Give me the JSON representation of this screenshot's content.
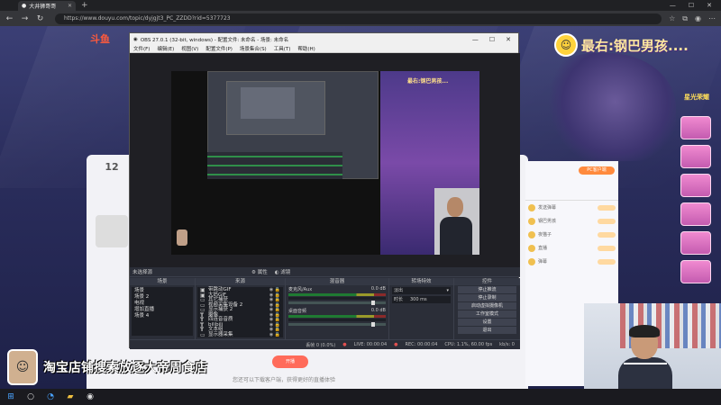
{
  "browser": {
    "tab_title": "大井狮哥哥",
    "url": "https://www.douyu.com/topic/dyjgjt3_PC_ZZDD?rid=5377723",
    "new_tab": "+",
    "win_min": "—",
    "win_max": "☐",
    "win_close": "✕"
  },
  "page": {
    "banner_text": "最右:钢巴男孩....",
    "brand": "斗鱼",
    "count": "12",
    "count_sub": "",
    "ribbon_text": "淘宝店铺搜索放逐大帝周食店",
    "bottom_button": "开播",
    "bottom_note": "您还可以下载客户端，获得更好的直播体验",
    "side_top": "星光荣耀"
  },
  "chat": {
    "pill": "PC客户端",
    "rows": [
      "发送弹幕",
      "钢巴男孩",
      "夜猫子",
      "直播",
      "弹幕"
    ]
  },
  "obs": {
    "title": "OBS 27.0.1 (32-bit, windows) - 配置文件: 未命名 - 场景: 未命名",
    "menu": [
      "文件(F)",
      "编辑(E)",
      "视图(V)",
      "配置文件(P)",
      "场景集合(S)",
      "工具(T)",
      "帮助(H)"
    ],
    "no_source_selected": "未选择源",
    "properties": "属性",
    "filters": "滤镜",
    "docks": {
      "scenes": "场景",
      "sources": "来源",
      "mixer": "混音器",
      "transitions": "转场特效",
      "controls": "控件"
    },
    "scenes": [
      "场景",
      "场景 2",
      "电视",
      "增加直播",
      "场景 4"
    ],
    "sources": [
      "带跳动GIF",
      "大妈GIF",
      "其它捕获",
      "视频采集设备 2",
      "显示捕获 2",
      "摄像",
      "四连音音质",
      "bilibili",
      "文本组",
      "显示器采集"
    ],
    "mixer": [
      {
        "name": "桌面音频",
        "value": "0.0 dB"
      },
      {
        "name": "麦克风/Aux",
        "value": "0.0 dB"
      }
    ],
    "transition": {
      "type_label": "",
      "type_value": "淡出",
      "duration_label": "时长",
      "duration_value": "300 ms"
    },
    "controls": [
      "停止推流",
      "停止录制",
      "启动虚拟摄像机",
      "工作室模式",
      "设置",
      "退出"
    ],
    "status": {
      "dropped": "丢帧 0 (0.0%)",
      "live": "LIVE: 00:00:04",
      "rec": "REC: 00:00:04",
      "cpu": "CPU: 1.1%, 60.00 fps",
      "kbps": "kb/s: 0"
    },
    "canvas_label": "最右:钢巴男孩..."
  },
  "taskbar": {
    "time": "",
    "icons": [
      "windows-icon",
      "search-icon",
      "edge-icon",
      "folder-icon",
      "obs-icon"
    ]
  },
  "colors": {
    "accent": "#ff6b5a",
    "banner": "#ffe8a0",
    "meter_green": "#1f7a32"
  }
}
